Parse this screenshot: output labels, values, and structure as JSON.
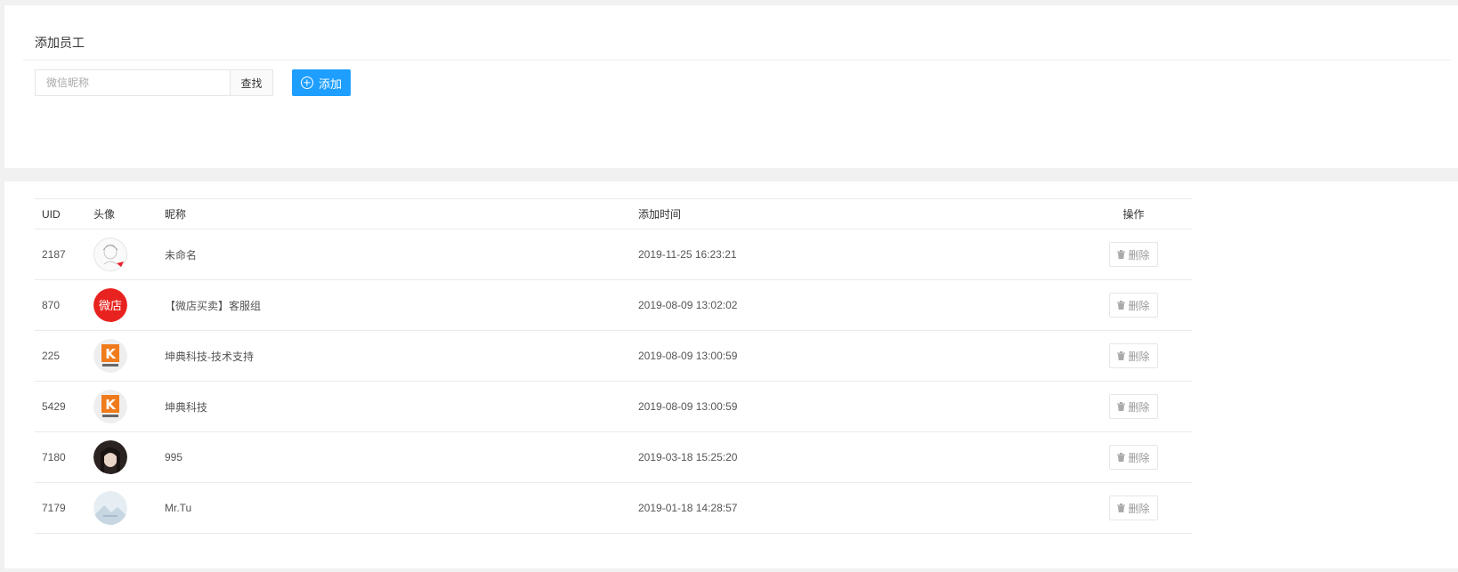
{
  "top": {
    "title": "添加员工",
    "search_placeholder": "微信昵称",
    "search_label": "查找",
    "add_label": "添加"
  },
  "table": {
    "headers": [
      "UID",
      "头像",
      "昵称",
      "添加时间",
      "操作"
    ],
    "rows": [
      {
        "uid": "2187",
        "avatar": "sketch-face-avatar",
        "nickname": "未命名",
        "time": "2019-11-25 16:23:21",
        "action": "删除"
      },
      {
        "uid": "870",
        "avatar": "weidian-logo-avatar",
        "avatar_text": "微店",
        "nickname": "【微店买卖】客服组",
        "time": "2019-08-09 13:02:02",
        "action": "删除"
      },
      {
        "uid": "225",
        "avatar": "kundian-logo-avatar",
        "avatar_text": "K",
        "nickname": "坤典科技-技术支持",
        "time": "2019-08-09 13:00:59",
        "action": "删除"
      },
      {
        "uid": "5429",
        "avatar": "kundian-logo-avatar",
        "avatar_text": "K",
        "nickname": "坤典科技",
        "time": "2019-08-09 13:00:59",
        "action": "删除"
      },
      {
        "uid": "7180",
        "avatar": "portrait-photo-avatar",
        "nickname": "995",
        "time": "2019-03-18 15:25:20",
        "action": "删除"
      },
      {
        "uid": "7179",
        "avatar": "landscape-avatar",
        "nickname": "Mr.Tu",
        "time": "2019-01-18 14:28:57",
        "action": "删除"
      }
    ]
  },
  "colors": {
    "primary": "#1e9fff",
    "weidian_red": "#e8231f",
    "kundian_orange": "#f07b1c"
  }
}
